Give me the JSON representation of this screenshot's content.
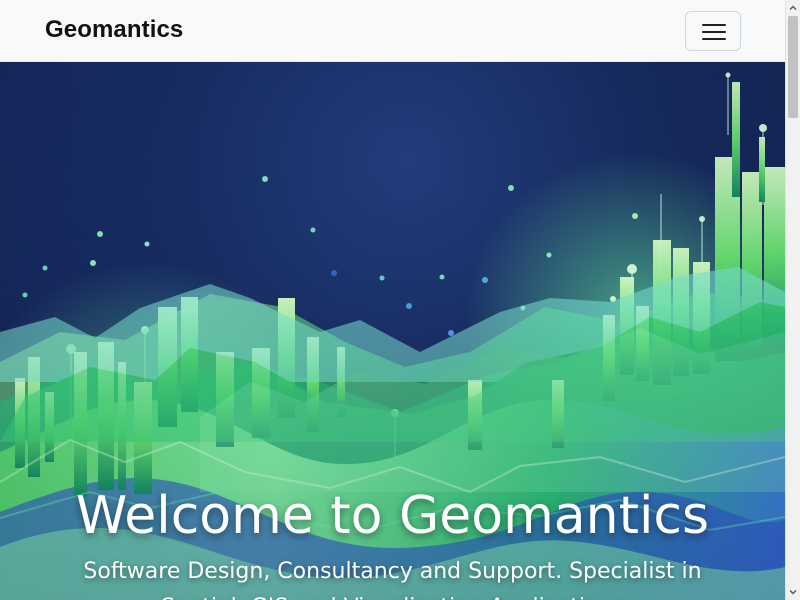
{
  "navbar": {
    "brand": "Geomantics",
    "menu_icon": "hamburger-icon",
    "background": "#f8f9fa"
  },
  "hero": {
    "title": "Welcome to Geomantics",
    "subtitle": "Software Design, Consultancy and Support. Specialist in Spatial, GIS and Visualization Applications",
    "background_colors": [
      "#0d1736",
      "#233b73",
      "#28d66b",
      "#69e6b0",
      "#2c58d1",
      "#a6f38a"
    ]
  },
  "scrollbar": {
    "up_icon": "chevron-up-icon",
    "down_icon": "chevron-down-icon",
    "thumb_color": "#c1c1c1"
  }
}
